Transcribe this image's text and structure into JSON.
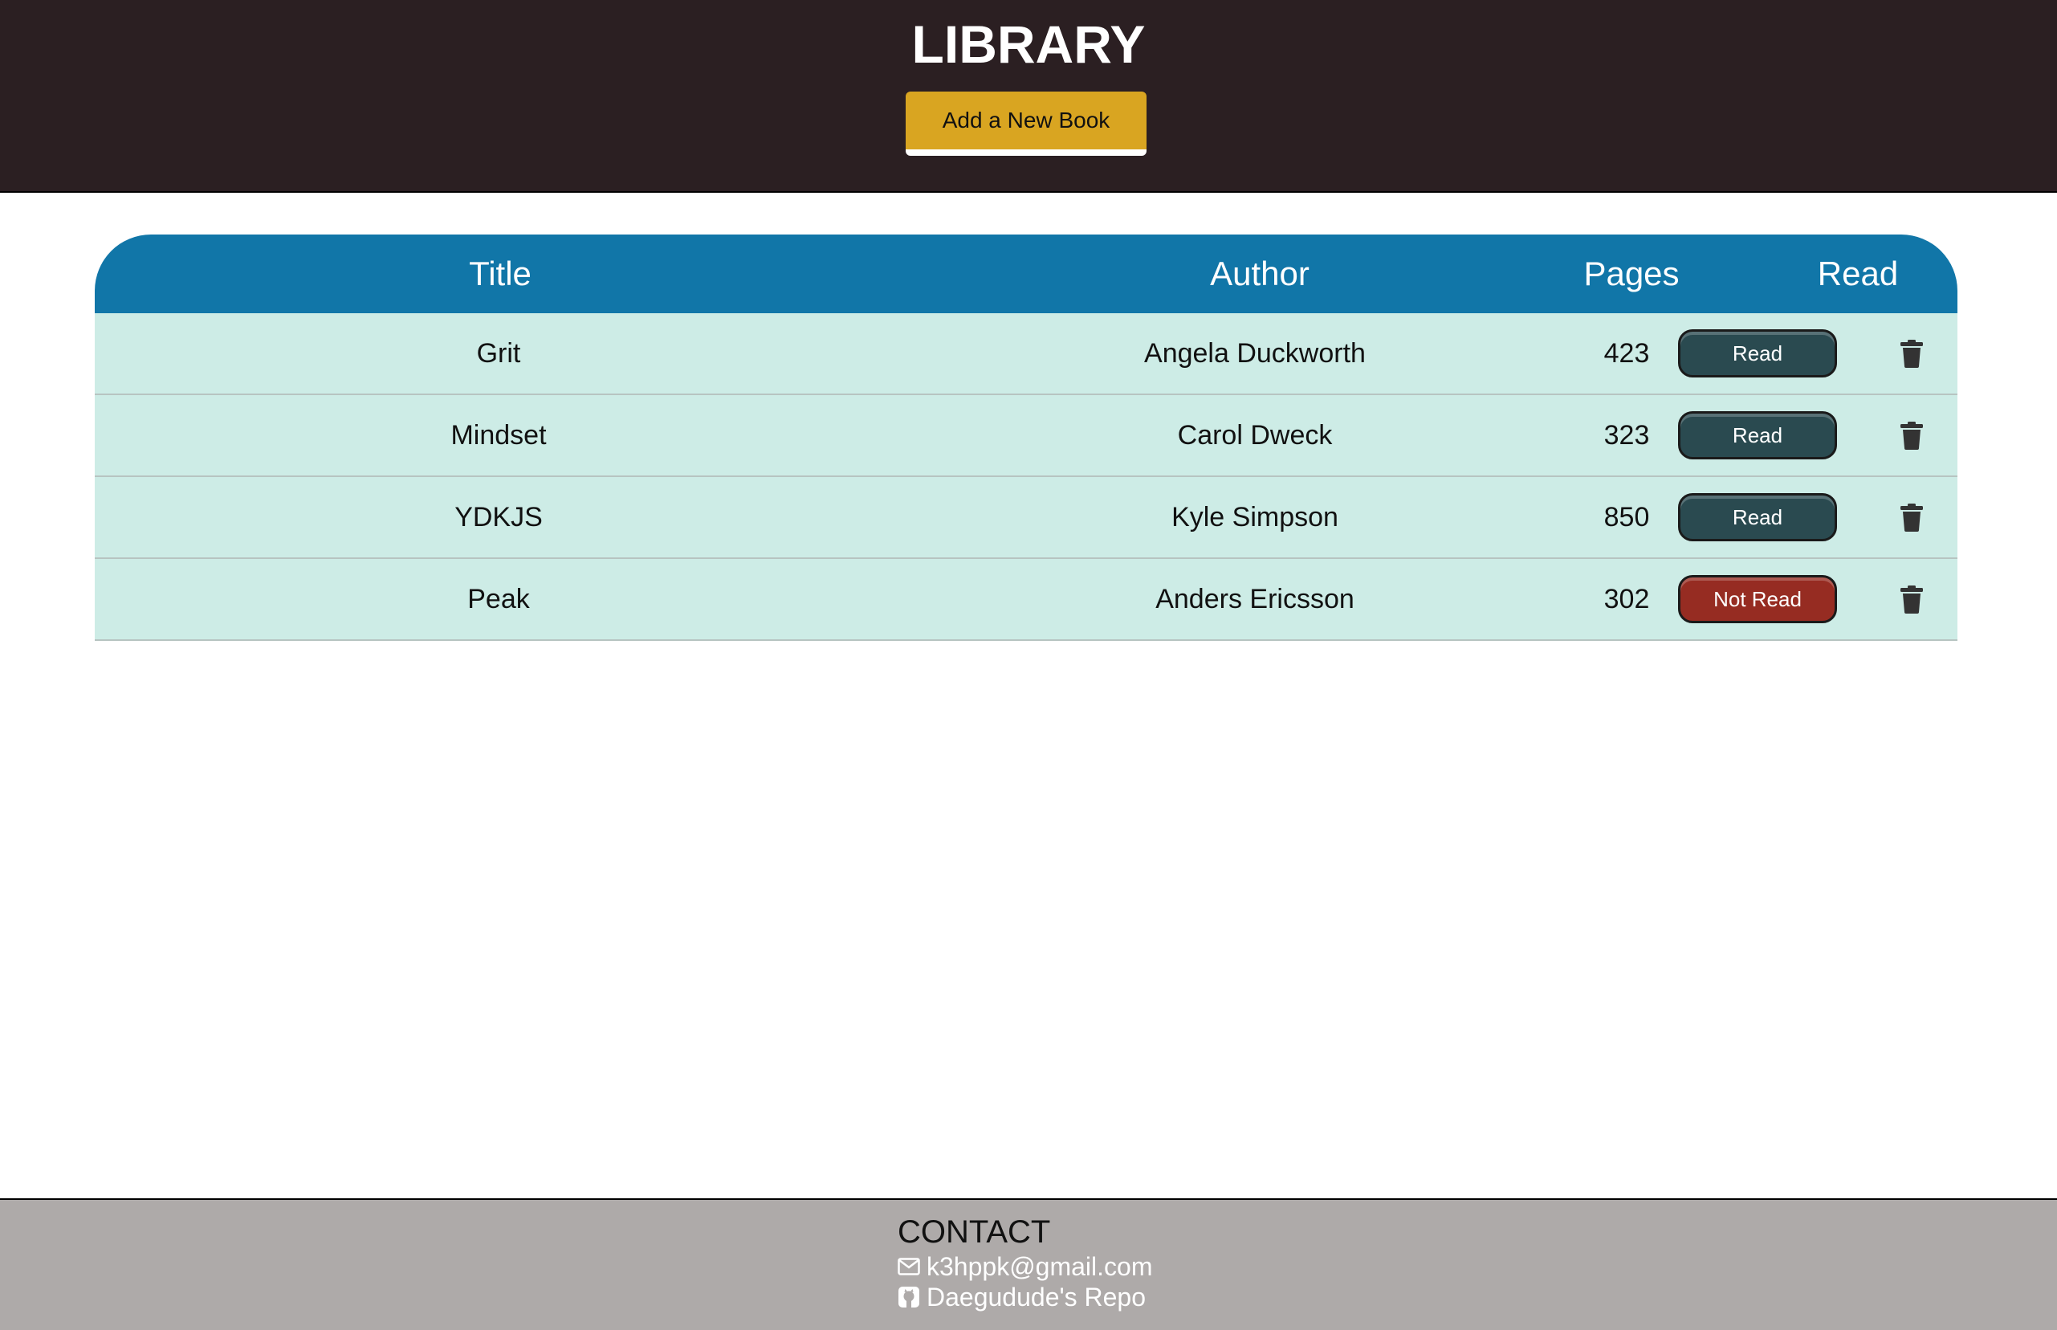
{
  "header": {
    "title": "LIBRARY",
    "add_button_label": "Add a New Book"
  },
  "table": {
    "columns": [
      "Title",
      "Author",
      "Pages",
      "Read"
    ],
    "rows": [
      {
        "title": "Grit",
        "author": "Angela Duckworth",
        "pages": "423",
        "status": "Read"
      },
      {
        "title": "Mindset",
        "author": "Carol Dweck",
        "pages": "323",
        "status": "Read"
      },
      {
        "title": "YDKJS",
        "author": "Kyle Simpson",
        "pages": "850",
        "status": "Read"
      },
      {
        "title": "Peak",
        "author": "Anders Ericsson",
        "pages": "302",
        "status": "Not Read"
      }
    ]
  },
  "footer": {
    "heading": "CONTACT",
    "email": "k3hppk@gmail.com",
    "repo": "Daegudude's Repo"
  },
  "colors": {
    "header_bg": "#2b1f22",
    "accent_button": "#d9a521",
    "table_header": "#1176a8",
    "row_bg": "#cdece6",
    "read_button": "#2a4a50",
    "not_read_button": "#962c22",
    "footer_bg": "#aeaaa9"
  },
  "icons": {
    "delete": "trash-icon",
    "email": "envelope-icon",
    "repo": "github-icon"
  }
}
